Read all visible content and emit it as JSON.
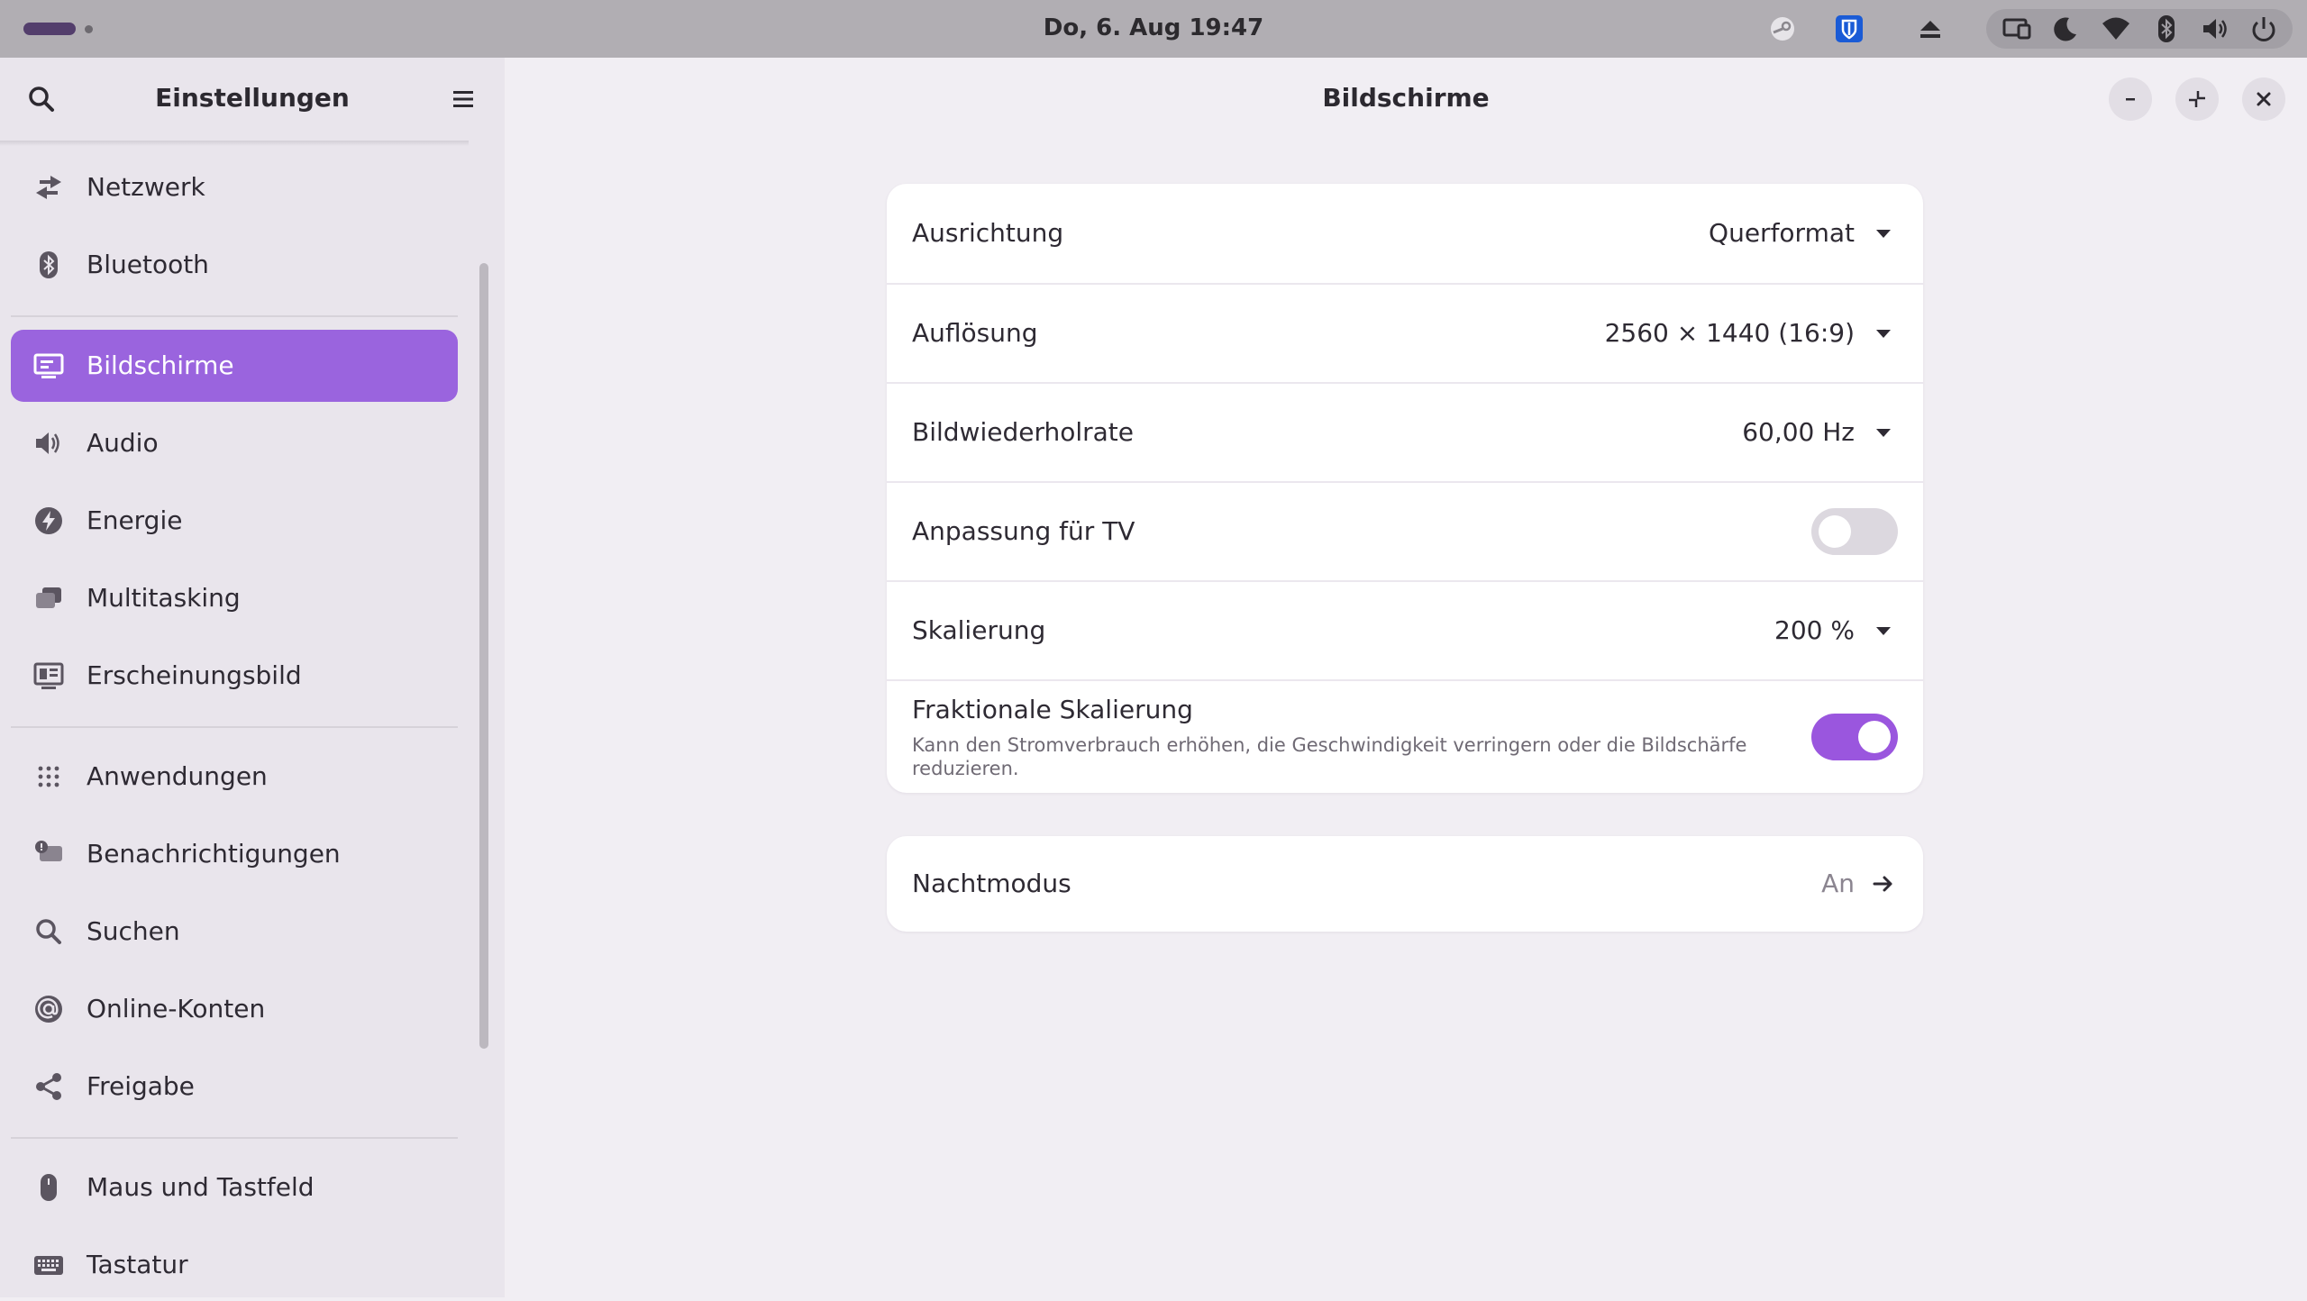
{
  "topbar": {
    "clock": "Do, 6. Aug  19:47",
    "tray_icons": [
      "steam-icon",
      "bitwarden-icon",
      "eject-icon"
    ],
    "status_icons": [
      "screen-share-icon",
      "night-light-icon",
      "wifi-icon",
      "bluetooth-icon",
      "volume-icon",
      "power-icon"
    ]
  },
  "sidebar": {
    "title": "Einstellungen",
    "items": [
      {
        "label": "Netzwerk",
        "icon": "network-icon"
      },
      {
        "label": "Bluetooth",
        "icon": "bluetooth-icon"
      },
      {
        "label": "Bildschirme",
        "icon": "display-icon",
        "active": true
      },
      {
        "label": "Audio",
        "icon": "speaker-icon"
      },
      {
        "label": "Energie",
        "icon": "power-bolt-icon"
      },
      {
        "label": "Multitasking",
        "icon": "multitasking-icon"
      },
      {
        "label": "Erscheinungsbild",
        "icon": "appearance-icon"
      },
      {
        "label": "Anwendungen",
        "icon": "apps-grid-icon"
      },
      {
        "label": "Benachrichtigungen",
        "icon": "notifications-icon"
      },
      {
        "label": "Suchen",
        "icon": "search-icon"
      },
      {
        "label": "Online-Konten",
        "icon": "online-accounts-icon"
      },
      {
        "label": "Freigabe",
        "icon": "share-icon"
      },
      {
        "label": "Maus und Tastfeld",
        "icon": "mouse-icon"
      },
      {
        "label": "Tastatur",
        "icon": "keyboard-icon"
      }
    ]
  },
  "main": {
    "title": "Bildschirme",
    "settings": [
      {
        "label": "Ausrichtung",
        "value": "Querformat"
      },
      {
        "label": "Auflösung",
        "value": "2560 × 1440 (16:9)"
      },
      {
        "label": "Bildwiederholrate",
        "value": "60,00 Hz"
      },
      {
        "label": "Anpassung für TV",
        "toggle": false
      },
      {
        "label": "Skalierung",
        "value": "200 %"
      },
      {
        "label": "Fraktionale Skalierung",
        "description": "Kann den Stromverbrauch erhöhen, die Geschwindigkeit verringern oder die Bildschärfe reduzieren.",
        "toggle": true
      }
    ],
    "night_mode": {
      "label": "Nachtmodus",
      "value": "An"
    }
  },
  "colors": {
    "accent": "#9a56de",
    "sidebar_active": "#9a64de",
    "topbar": "#b1aeb3"
  }
}
